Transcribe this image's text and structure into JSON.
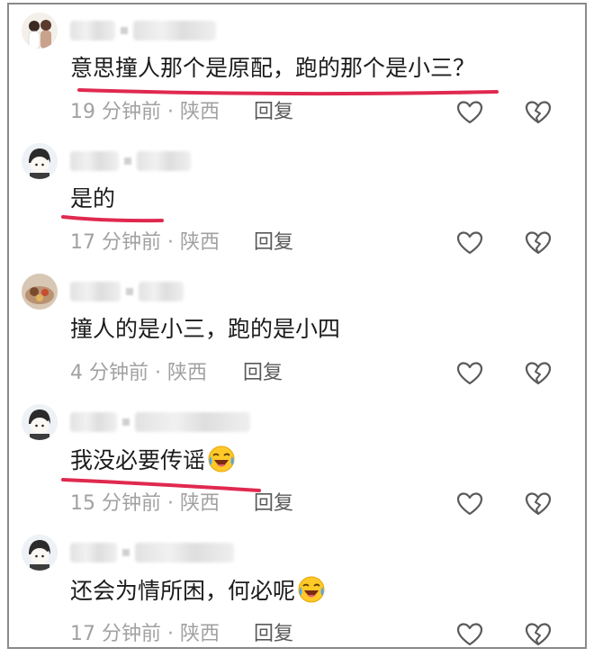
{
  "comments": [
    {
      "text": "意思撞人那个是原配，跑的那个是小三？",
      "time": "19 分钟前",
      "location": "陕西",
      "reply": "回复",
      "avatar": "couple-avatar",
      "emoji": false
    },
    {
      "text": "是的",
      "time": "17 分钟前",
      "location": "陕西",
      "reply": "回复",
      "avatar": "cartoon-boy-avatar",
      "emoji": false
    },
    {
      "text": "撞人的是小三，跑的是小四",
      "time": "4 分钟前",
      "location": "陕西",
      "reply": "回复",
      "avatar": "food-photo-avatar",
      "emoji": false
    },
    {
      "text": "我没必要传谣",
      "time": "15 分钟前",
      "location": "陕西",
      "reply": "回复",
      "avatar": "cartoon-boy-avatar",
      "emoji": true
    },
    {
      "text": "还会为情所困，何必呢",
      "time": "17 分钟前",
      "location": "陕西",
      "reply": "回复",
      "avatar": "cartoon-boy-avatar",
      "emoji": true
    }
  ],
  "icons": {
    "like": "heart-outline-icon",
    "dislike": "broken-heart-icon",
    "emoji": "crying-laughing-emoji"
  },
  "colors": {
    "annotation_underline": "#e0294f",
    "meta_text": "#a1a1a1",
    "reply_text": "#5a5a5a",
    "comment_text": "#1c1c1c"
  }
}
